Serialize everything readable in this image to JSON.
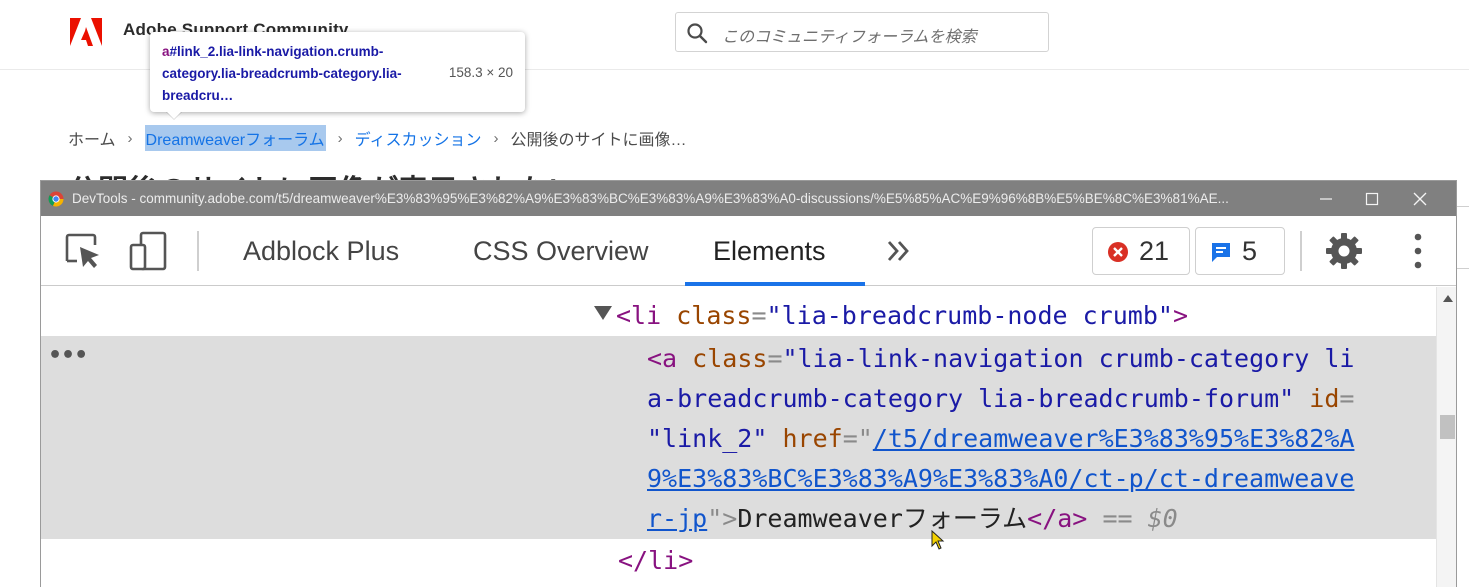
{
  "site": {
    "logo_text": "A",
    "title": "Adobe Support Community",
    "search_placeholder": "このコミュニティフォーラムを検索"
  },
  "inspect_tooltip": {
    "tag": "a",
    "selector_rest": "#link_2.lia-link-navigation.crumb-category.lia-breadcrumb-category.lia-breadcru…",
    "dimensions": "158.3 × 20"
  },
  "breadcrumb": {
    "home": "ホーム",
    "sep": "›",
    "forum": "Dreamweaverフォーラム",
    "discussions": "ディスカッション",
    "current": "公開後のサイトに画像…"
  },
  "page_heading": "公開後のサイトに画像が表示されない",
  "devtools": {
    "title": "DevTools - community.adobe.com/t5/dreamweaver%E3%83%95%E3%82%A9%E3%83%BC%E3%83%A9%E3%83%A0-discussions/%E5%85%AC%E9%96%8B%E5%BE%8C%E3%81%AE...",
    "tabs": [
      "Adblock Plus",
      "CSS Overview",
      "Elements"
    ],
    "active_tab": "Elements",
    "more_tabs": "»",
    "errors_count": "21",
    "messages_count": "5",
    "colors": {
      "accent": "#1a73e8",
      "error": "#d93025",
      "titlebar": "#808080"
    },
    "dom": {
      "li_open": {
        "tag_open": "<li",
        "attr": "class",
        "eq": "=",
        "value": "\"lia-breadcrumb-node crumb\"",
        "close": ">"
      },
      "a_line1": {
        "tag_open": "<a",
        "attr": "class",
        "eq": "=",
        "value": "\"lia-link-navigation crumb-category li"
      },
      "a_line2": {
        "value": "a-breadcrumb-category lia-breadcrumb-forum\"",
        "attr": "id",
        "eq": "="
      },
      "a_line3": {
        "value": "\"link_2\"",
        "attr": "href",
        "eq": "=\"",
        "link": "/t5/dreamweaver%E3%83%95%E3%82%A"
      },
      "a_line4": {
        "link": "9%E3%83%BC%E3%83%A9%E3%83%A0/ct-p/ct-dreamweave"
      },
      "a_line5": {
        "link": "r-jp",
        "quote_close": "\">",
        "text": "Dreamweaverフォーラム",
        "tag_close": "</a>",
        "marker": "== $0"
      },
      "li_close": "</li>",
      "ellipsis": "•••"
    }
  }
}
